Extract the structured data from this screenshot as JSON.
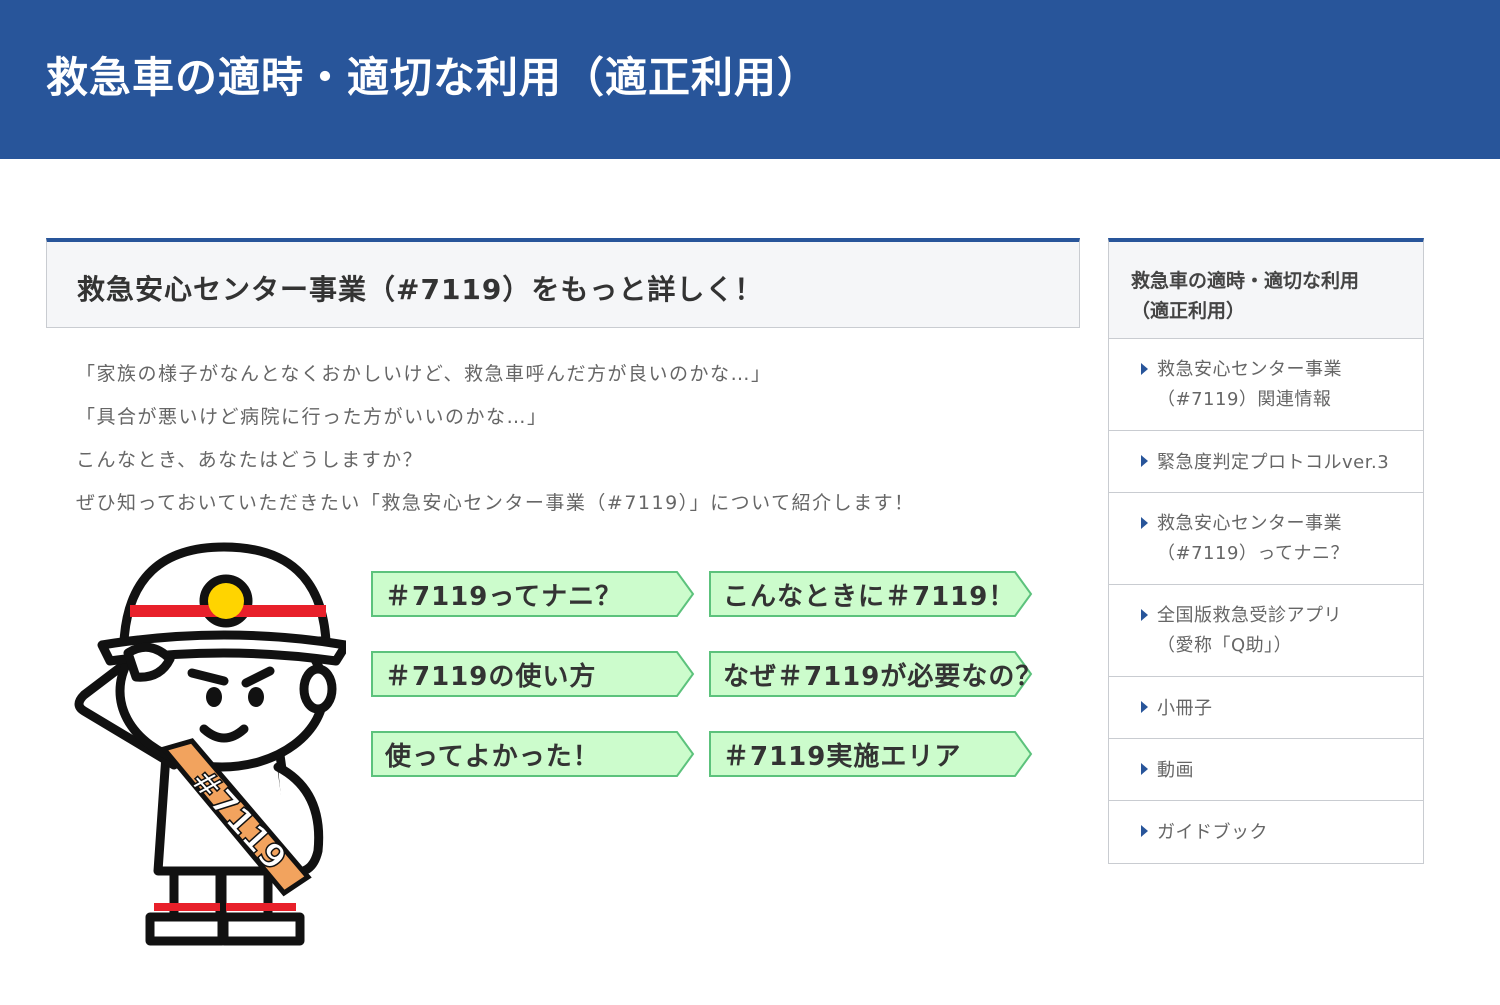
{
  "banner": {
    "title": "救急車の適時・適切な利用（適正利用）"
  },
  "section": {
    "heading": "救急安心センター事業（#7119）をもっと詳しく！"
  },
  "intro": [
    "「家族の様子がなんとなくおかしいけど、救急車呼んだ方が良いのかな…」",
    "「具合が悪いけど病院に行った方がいいのかな…」",
    "こんなとき、あなたはどうしますか？",
    "ぜひ知っておいていただきたい「救急安心センター事業（#7119）」について紹介します！"
  ],
  "mascot": {
    "sash_text": "#7119"
  },
  "buttons": [
    {
      "label": "＃7119ってナニ？"
    },
    {
      "label": "こんなときに＃7119！"
    },
    {
      "label": "＃7119の使い方"
    },
    {
      "label": "なぜ＃7119が必要なの？"
    },
    {
      "label": "使ってよかった！"
    },
    {
      "label": "＃7119実施エリア"
    }
  ],
  "sidebar": {
    "heading_line1": "救急車の適時・適切な利用",
    "heading_line2": "（適正利用）",
    "items": [
      {
        "line1": "救急安心センター事業",
        "line2": "（#7119）関連情報"
      },
      {
        "line1": "緊急度判定プロトコルver.3",
        "line2": ""
      },
      {
        "line1": "救急安心センター事業",
        "line2": "（#7119）ってナニ？"
      },
      {
        "line1": "全国版救急受診アプリ",
        "line2": "（愛称「Q助」）"
      },
      {
        "line1": "小冊子",
        "line2": ""
      },
      {
        "line1": "動画",
        "line2": ""
      },
      {
        "line1": "ガイドブック",
        "line2": ""
      }
    ]
  },
  "colors": {
    "brand": "#28559a",
    "button_fill": "#ccfccc",
    "button_border": "#5cc27c",
    "helmet_red": "#e8202a",
    "helmet_badge": "#ffd400",
    "sash": "#f2a35e"
  }
}
